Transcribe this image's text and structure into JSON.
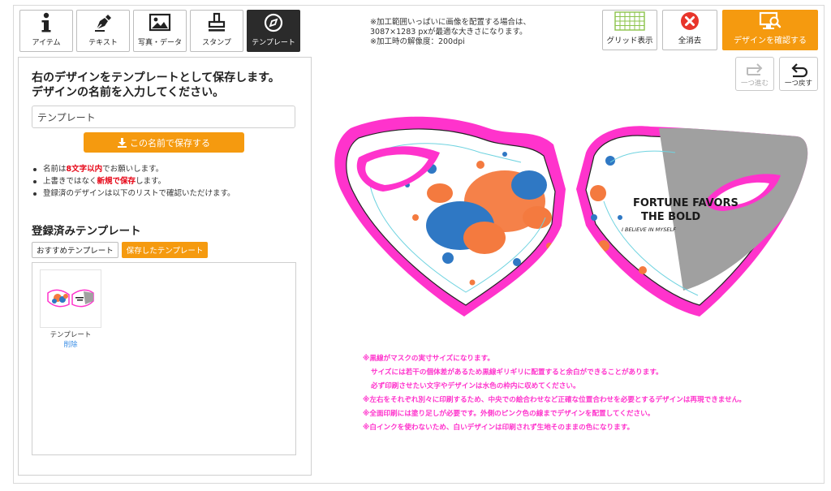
{
  "tabs": [
    {
      "label": "アイテム",
      "icon": "info-icon"
    },
    {
      "label": "テキスト",
      "icon": "pen-icon"
    },
    {
      "label": "写真・データ",
      "icon": "image-icon"
    },
    {
      "label": "スタンプ",
      "icon": "stamp-icon"
    },
    {
      "label": "テンプレート",
      "icon": "compass-icon",
      "active": true
    }
  ],
  "top_notice": "※加工範囲いっぱいに画像を配置する場合は、\n3087×1283 pxが最適な大きさになります。\n※加工時の解像度：200dpi",
  "toolbar": {
    "grid_label": "グリッド表示",
    "clear_label": "全消去",
    "confirm_label": "デザインを確認する",
    "redo_label": "一つ進む",
    "undo_label": "一つ戻す"
  },
  "panel": {
    "title_line1": "右のデザインをテンプレートとして保存します。",
    "title_line2": "デザインの名前を入力してください。",
    "name_input_value": "テンプレート",
    "save_button": "この名前で保存する",
    "notes": {
      "n1_pre": "名前は",
      "n1_em": "8文字以内",
      "n1_post": "でお願いします。",
      "n2_pre": "上書きではなく",
      "n2_em": "新規で保存",
      "n2_post": "します。",
      "n3": "登録済のデザインは以下のリストで確認いただけます。"
    },
    "registered_title": "登録済みテンプレート",
    "template_tabs": {
      "recommended": "おすすめテンプレート",
      "saved": "保存したテンプレート"
    },
    "saved_items": [
      {
        "name": "テンプレート",
        "delete_label": "削除"
      }
    ]
  },
  "design": {
    "text_line1": "FORTUNE FAVORS",
    "text_line2": "THE BOLD",
    "text_line3": "I BELIEVE IN MYSELF"
  },
  "warnings": [
    "※黒線がマスクの実寸サイズになります。",
    "サイズには若干の個体差があるため黒線ギリギリに配置すると余白ができることがあります。",
    "必ず印刷させたい文字やデザインは水色の枠内に収めてください。",
    "※左右をそれぞれ別々に印刷するため、中央での絵合わせなど正確な位置合わせを必要とするデザインは再現できません。",
    "※全面印刷には塗り足しが必要です。外側のピンク色の線までデザインを配置してください。",
    "※白インクを使わないため、白いデザインは印刷されず生地そのままの色になります。"
  ],
  "colors": {
    "accent": "#f59a0f",
    "magenta": "#ff33cc",
    "splash_orange": "#f47a3f",
    "splash_blue": "#2f78c4",
    "grey_panel": "#a0a0a0"
  }
}
